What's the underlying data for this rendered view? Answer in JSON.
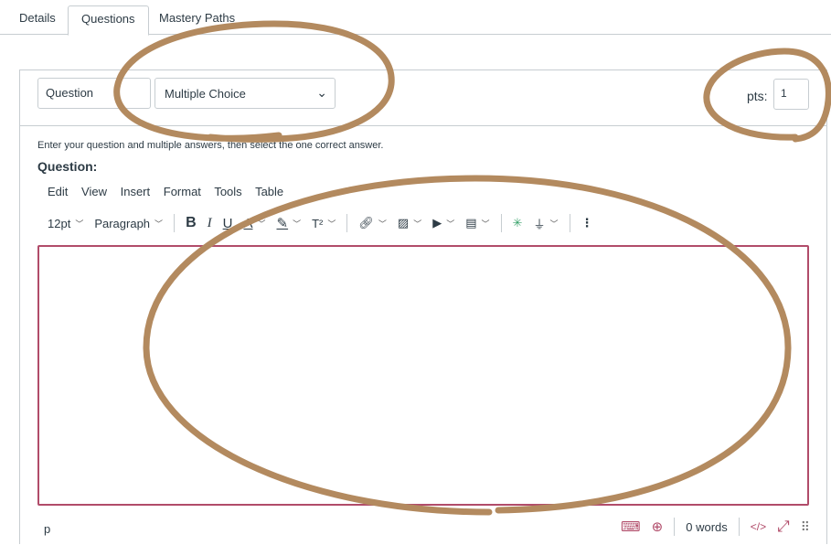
{
  "tabs": [
    {
      "label": "Details"
    },
    {
      "label": "Questions"
    },
    {
      "label": "Mastery Paths"
    }
  ],
  "question": {
    "name_value": "Question",
    "type_value": "Multiple Choice",
    "pts_label": "pts:",
    "pts_value": "1",
    "instructions": "Enter your question and multiple answers, then select the one correct answer.",
    "question_label": "Question:"
  },
  "editor": {
    "menu": [
      "Edit",
      "View",
      "Insert",
      "Format",
      "Tools",
      "Table"
    ],
    "font_size": "12pt",
    "block_format": "Paragraph",
    "path": "p",
    "word_count": "0 words",
    "html_toggle": "</>",
    "border_color": "#b14c6a"
  },
  "annotation_color": "#b38a5f"
}
